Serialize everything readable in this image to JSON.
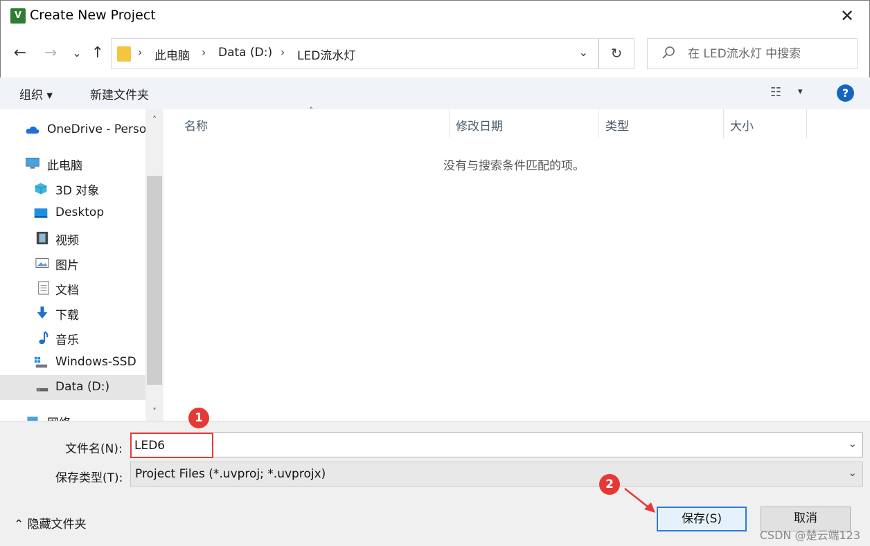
{
  "window": {
    "title": "Create New Project",
    "app_icon_letter": "V",
    "close_glyph": "✕"
  },
  "nav_buttons": {
    "back": "←",
    "forward": "→",
    "recent": "⌄",
    "up": "↑"
  },
  "address": {
    "breadcrumbs": [
      "此电脑",
      "Data (D:)",
      "LED流水灯"
    ],
    "separator": "›",
    "dropdown_glyph": "⌄",
    "refresh_glyph": "↻"
  },
  "search": {
    "placeholder": "在 LED流水灯 中搜索",
    "icon": "search-icon"
  },
  "toolbar": {
    "organize_label": "组织 ▾",
    "new_folder_label": "新建文件夹",
    "view_icon": "☷",
    "view_dropdown": "▾",
    "help_label": "?"
  },
  "nav_pane": {
    "items": [
      {
        "label": "OneDrive - Personal",
        "icon": "cloud-icon"
      },
      {
        "label": "此电脑",
        "icon": "computer-icon"
      },
      {
        "label": "3D 对象",
        "icon": "cube-icon"
      },
      {
        "label": "Desktop",
        "icon": "desktop-icon"
      },
      {
        "label": "视频",
        "icon": "video-icon"
      },
      {
        "label": "图片",
        "icon": "picture-icon"
      },
      {
        "label": "文档",
        "icon": "document-icon"
      },
      {
        "label": "下载",
        "icon": "download-icon"
      },
      {
        "label": "音乐",
        "icon": "music-icon"
      },
      {
        "label": "Windows-SSD",
        "icon": "drive-icon"
      },
      {
        "label": "Data (D:)",
        "icon": "drive-icon"
      },
      {
        "label": "网络",
        "icon": "network-icon"
      }
    ],
    "scroll_up": "˄",
    "scroll_down": "˅"
  },
  "file_list": {
    "columns": [
      "名称",
      "修改日期",
      "类型",
      "大小"
    ],
    "sort_indicator": "˄",
    "empty_message": "没有与搜索条件匹配的项。"
  },
  "bottom": {
    "filename_label": "文件名(N):",
    "filename_value": "LED6",
    "filetype_label": "保存类型(T):",
    "filetype_value": "Project Files (*.uvproj; *.uvprojx)",
    "dropdown_glyph": "⌄",
    "hide_folders_label": "⌃  隐藏文件夹",
    "save_label": "保存(S)",
    "cancel_label": "取消"
  },
  "annotations": {
    "step1": "1",
    "step2": "2",
    "highlight_color": "#e53935"
  },
  "watermark": "CSDN @楚云端123"
}
